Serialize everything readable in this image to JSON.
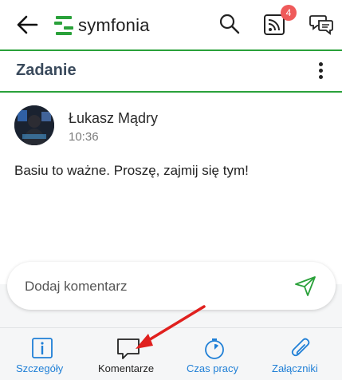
{
  "app": {
    "logo_text": "symfonia"
  },
  "header": {
    "notification_count": "4"
  },
  "title_bar": {
    "title": "Zadanie"
  },
  "comment": {
    "author": "Łukasz Mądry",
    "time": "10:36",
    "text": "Basiu to ważne. Proszę, zajmij się tym!"
  },
  "composer": {
    "placeholder": "Dodaj komentarz"
  },
  "bottom_nav": {
    "items": [
      {
        "label": "Szczegóły",
        "icon": "info-icon",
        "active": false
      },
      {
        "label": "Komentarze",
        "icon": "comment-icon",
        "active": true
      },
      {
        "label": "Czas pracy",
        "icon": "timer-icon",
        "active": false
      },
      {
        "label": "Załączniki",
        "icon": "paperclip-icon",
        "active": false
      }
    ]
  },
  "colors": {
    "accent_green": "#2aa13a",
    "link_blue": "#1f7fd6",
    "badge_red": "#ef5a5a",
    "annotation_arrow": "#e0201e"
  }
}
